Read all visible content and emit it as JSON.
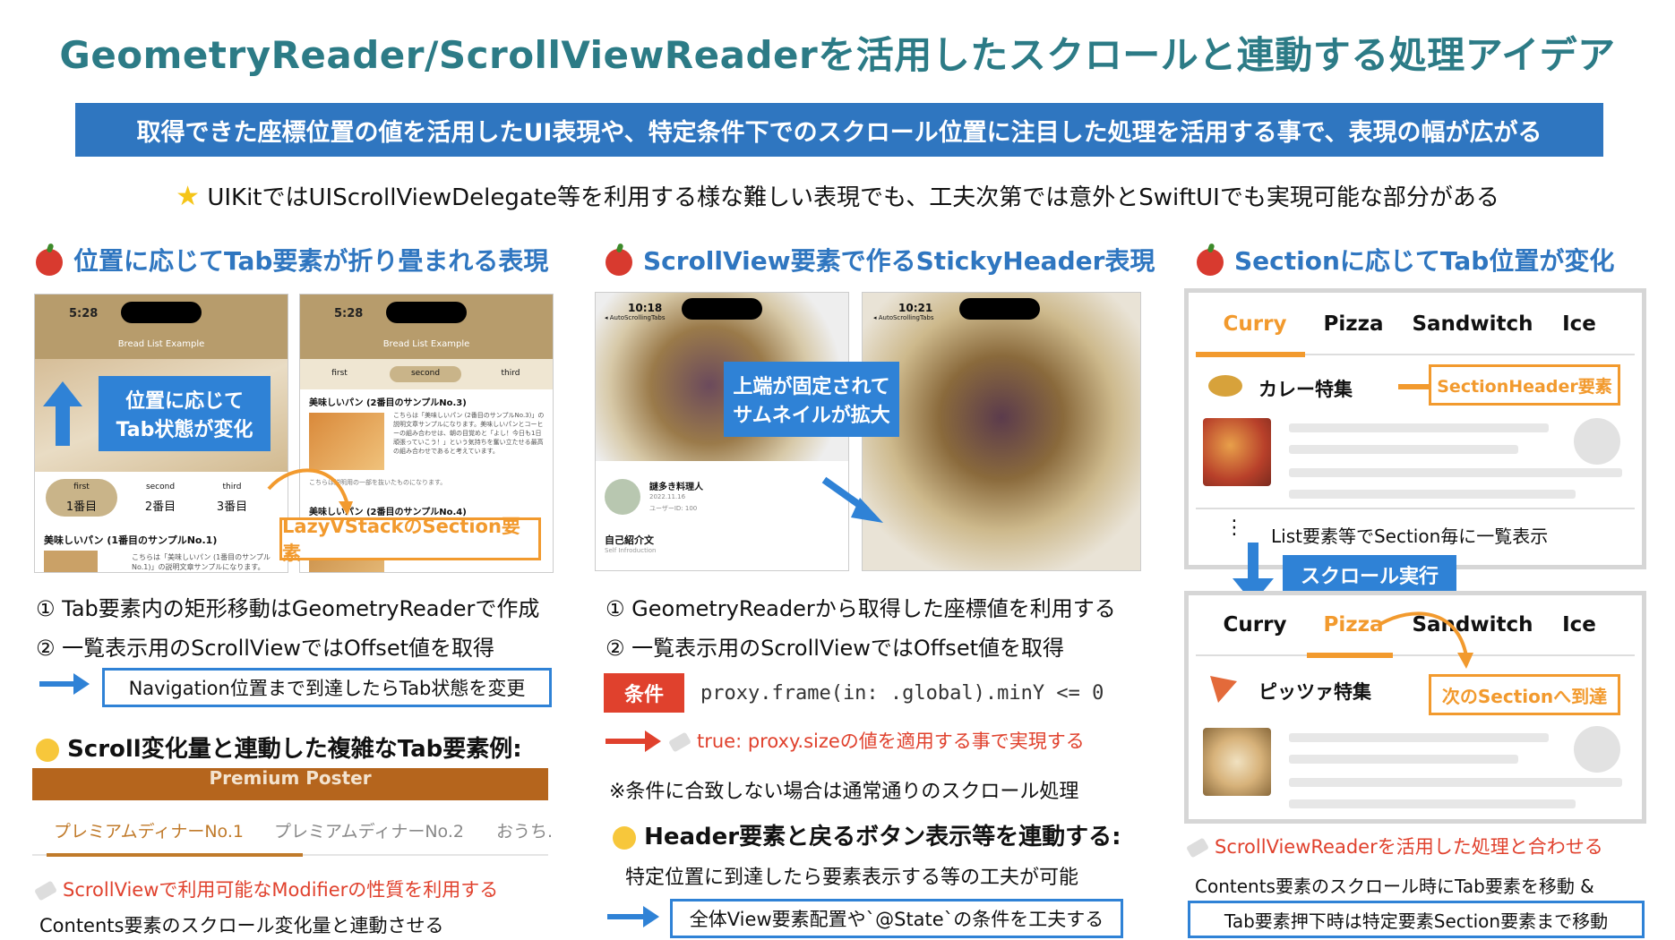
{
  "title": "GeometryReader/ScrollViewReaderを活用したスクロールと連動する処理アイデア",
  "banner": "取得できた座標位置の値を活用したUI表現や、特定条件下でのスクロール位置に注目した処理を活用する事で、表現の幅が広がる",
  "star_note": "UIKitではUIScrollViewDelegate等を利用する様な難しい表現でも、工夫次第では意外とSwiftUIでも実現可能な部分がある",
  "col1": {
    "heading": "位置に応じてTab要素が折り畳まれる表現",
    "phone1": {
      "time": "5:28",
      "nav_title": "Bread List Example",
      "tabs": [
        "first",
        "second",
        "third"
      ],
      "tab_labels": [
        "1番目",
        "2番目",
        "3番目"
      ],
      "row": "美味しいパン (1番目のサンプルNo.1)",
      "desc": "こちらは「美味しいパン (1番目のサンプルNo.1)」の説明文章サンプルになります。"
    },
    "phone2": {
      "time": "5:28",
      "nav_title": "Bread List Example",
      "tabs": [
        "first",
        "second",
        "third"
      ],
      "row1": "美味しいパン (2番目のサンプルNo.3)",
      "desc1": "こちらは「美味しいパン (2番目のサンプルNo.3)」の説明文章サンプルになります。美味しいパンとコーヒーの組み合わせは、朝の目覚めと「よし！今日も1日頑張っていこう！」という気持ちを奮い立たせる最高の組み合わせであると考えています。",
      "small": "こちらは説明用の一部を抜いたものになります。",
      "row2": "美味しいパン (2番目のサンプルNo.4)"
    },
    "callout": "位置に応じて\nTab状態が変化",
    "callout_line1": "位置に応じて",
    "callout_line2": "Tab状態が変化",
    "lazy_label": "LazyVStackのSection要素",
    "step1": "① Tab要素内の矩形移動はGeometryReaderで作成",
    "step2": "② 一覧表示用のScrollViewではOffset値を取得",
    "boxed": "Navigation位置まで到達したらTab状態を変更",
    "sub_heading": "Scroll変化量と連動した複雑なTab要素例:",
    "poster_title": "Premium Poster",
    "poster_tabs": [
      "プレミアムディナーNo.1",
      "プレミアムディナーNo.2",
      "おうち."
    ],
    "pin_note": "ScrollViewで利用可能なModifierの性質を利用する",
    "last_note": "Contents要素のスクロール変化量と連動させる"
  },
  "col2": {
    "heading": "ScrollView要素で作るStickyHeader表現",
    "phoneA": {
      "time": "10:18",
      "back": "◂ AutoScrollingTabs",
      "user": "謎多き料理人",
      "date": "2022.11.16",
      "user_id": "ユーザーID: 100",
      "section": "自己紹介文",
      "section_sub": "Self Infroduction"
    },
    "phoneB": {
      "time": "10:21",
      "back": "◂ AutoScrollingTabs"
    },
    "callout_line1": "上端が固定されて",
    "callout_line2": "サムネイルが拡大",
    "step1": "① GeometryReaderから取得した座標値を利用する",
    "step2": "② 一覧表示用のScrollViewではOffset値を取得",
    "cond_label": "条件",
    "code": "proxy.frame(in: .global).minY <= 0",
    "result": "true: proxy.sizeの値を適用する事で実現する",
    "else_note": "※条件に合致しない場合は通常通りのスクロール処理",
    "sub_heading": "Header要素と戻るボタン表示等を連動する:",
    "sub_note": "特定位置に到達したら要素表示する等の工夫が可能",
    "boxed": "全体View要素配置や`@State`の条件を工夫する"
  },
  "col3": {
    "heading": "Sectionに応じてTab位置が変化",
    "tabs": [
      "Curry",
      "Pizza",
      "Sandwitch",
      "Ice"
    ],
    "curry_header": "カレー特集",
    "section_header_label": "SectionHeader要素",
    "list_note": "List要素等でSection毎に一覧表示",
    "scroll_label": "スクロール実行",
    "pizza_header": "ピッツァ特集",
    "next_section_label": "次のSectionへ到達",
    "dots": "⋮",
    "pin_note": "ScrollViewReaderを活用した処理と合わせる",
    "note2": "Contents要素のスクロール時にTab要素を移動 &",
    "boxed": "Tab要素押下時は特定要素Section要素まで移動"
  },
  "colors": {
    "title": "#2c7b86",
    "banner": "#2f76c0",
    "accent_blue": "#2f82d6",
    "accent_orange": "#f29a2e",
    "accent_red": "#e0412d"
  }
}
